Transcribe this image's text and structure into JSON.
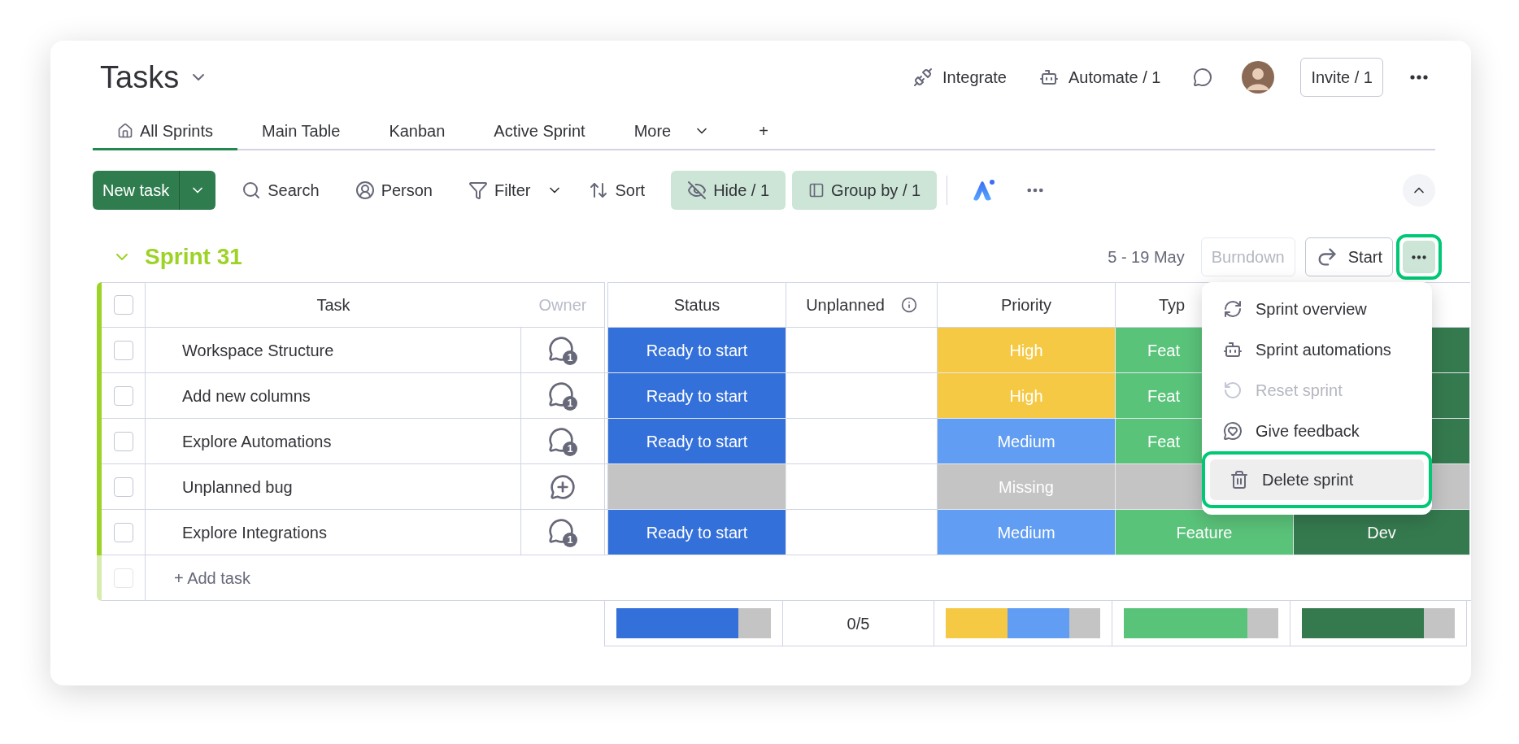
{
  "board": {
    "title": "Tasks"
  },
  "header_actions": [
    {
      "kind": "integrate",
      "label": "Integrate"
    },
    {
      "kind": "automate",
      "label": "Automate / 1"
    },
    {
      "kind": "updates"
    },
    {
      "kind": "avatar"
    },
    {
      "kind": "invite",
      "label": "Invite / 1"
    },
    {
      "kind": "more"
    }
  ],
  "tabs": [
    {
      "kind": "home",
      "label": "All Sprints",
      "selected": true
    },
    {
      "kind": "plain",
      "label": "Main Table",
      "selected": false
    },
    {
      "kind": "plain",
      "label": "Kanban",
      "selected": false
    },
    {
      "kind": "plain",
      "label": "Active Sprint",
      "selected": false
    },
    {
      "kind": "dropdown",
      "label": "More",
      "selected": false
    },
    {
      "kind": "plain",
      "label": "+",
      "selected": false
    }
  ],
  "toolbar": [
    {
      "kind": "split",
      "label": "New task",
      "active": false
    },
    {
      "kind": "search",
      "label": "Search",
      "active": false
    },
    {
      "kind": "person",
      "label": "Person",
      "active": false
    },
    {
      "kind": "filter",
      "label": "Filter",
      "active": false
    },
    {
      "kind": "sort",
      "label": "Sort",
      "active": false
    },
    {
      "kind": "hide",
      "label": "Hide / 1",
      "active": true
    },
    {
      "kind": "group",
      "label": "Group by / 1",
      "active": true
    },
    {
      "kind": "ai",
      "active": false
    },
    {
      "kind": "more",
      "active": false
    }
  ],
  "group": {
    "title": "Sprint 31",
    "expanded": true,
    "dates": "5 - 19 May",
    "actions": [
      {
        "kind": "burndown",
        "label": "Burndown",
        "disabled": true
      },
      {
        "kind": "start",
        "label": "Start",
        "disabled": false
      },
      {
        "kind": "more",
        "disabled": false,
        "highlighted": true
      }
    ]
  },
  "table": {
    "checked": false,
    "columns": [
      {
        "label": "Task"
      },
      {
        "label": "Owner"
      },
      {
        "label": "Status"
      },
      {
        "label": "Unplanned",
        "info": true
      },
      {
        "label": "Priority"
      },
      {
        "label": "Typ"
      }
    ],
    "rows": [
      {
        "checked": false,
        "task": "Workspace Structure",
        "owner": {
          "kind": "comments",
          "count": "1"
        },
        "status": {
          "label": "Ready to start",
          "color": "#3470d9"
        },
        "priority": {
          "label": "High",
          "color": "#f6c945"
        },
        "type": {
          "label": "Feat",
          "color": "#5ac37a"
        },
        "column_7": {
          "color": "#357a4f"
        }
      },
      {
        "checked": false,
        "task": "Add new columns",
        "owner": {
          "kind": "comments",
          "count": "1"
        },
        "status": {
          "label": "Ready to start",
          "color": "#3470d9"
        },
        "priority": {
          "label": "High",
          "color": "#f6c945"
        },
        "type": {
          "label": "Feat",
          "color": "#5ac37a"
        },
        "column_7": {
          "color": "#357a4f"
        }
      },
      {
        "checked": false,
        "task": "Explore Automations",
        "owner": {
          "kind": "comments",
          "count": "1"
        },
        "status": {
          "label": "Ready to start",
          "color": "#3470d9"
        },
        "priority": {
          "label": "Medium",
          "color": "#619df2"
        },
        "type": {
          "label": "Feat",
          "color": "#5ac37a"
        },
        "column_7": {
          "color": "#357a4f"
        }
      },
      {
        "checked": false,
        "task": "Unplanned bug",
        "owner": {
          "kind": "add"
        },
        "status": {
          "color": "#c4c4c4"
        },
        "priority": {
          "label": "Missing",
          "color": "#c4c4c4"
        },
        "type": {
          "color": "#c4c4c4"
        },
        "column_7": {
          "color": "#c4c4c4"
        }
      },
      {
        "checked": false,
        "task": "Explore Integrations",
        "owner": {
          "kind": "comments",
          "count": "1"
        },
        "status": {
          "label": "Ready to start",
          "color": "#3470d9"
        },
        "priority": {
          "label": "Medium",
          "color": "#619df2"
        },
        "type": {
          "label": "Feature",
          "color": "#5ac37a"
        },
        "column_7": {
          "label": "Dev",
          "color": "#357a4f"
        }
      }
    ],
    "add_task": {
      "label": "+ Add task",
      "checked": false
    },
    "summary": {
      "status": [
        {
          "color": "#3470d9",
          "level": 0.79
        }
      ],
      "unplanned": "0/5",
      "priority": [
        {
          "color": "#f6c945",
          "level": 0.4
        },
        {
          "color": "#619df2",
          "level": 0.8
        }
      ],
      "type": [
        {
          "color": "#5ac37a",
          "level": 0.8
        }
      ],
      "column_7": [
        {
          "color": "#357a4f",
          "level": 0.8
        }
      ]
    }
  },
  "menu": {
    "items": [
      {
        "kind": "overview",
        "label": "Sprint overview",
        "disabled": false,
        "highlighted": false
      },
      {
        "kind": "automations",
        "label": "Sprint automations",
        "disabled": false,
        "highlighted": false
      },
      {
        "kind": "reset",
        "label": "Reset sprint",
        "disabled": true,
        "highlighted": false
      },
      {
        "kind": "feedback",
        "label": "Give feedback",
        "disabled": false,
        "highlighted": false
      },
      {
        "kind": "delete",
        "label": "Delete sprint",
        "disabled": false,
        "highlighted": true
      }
    ]
  }
}
